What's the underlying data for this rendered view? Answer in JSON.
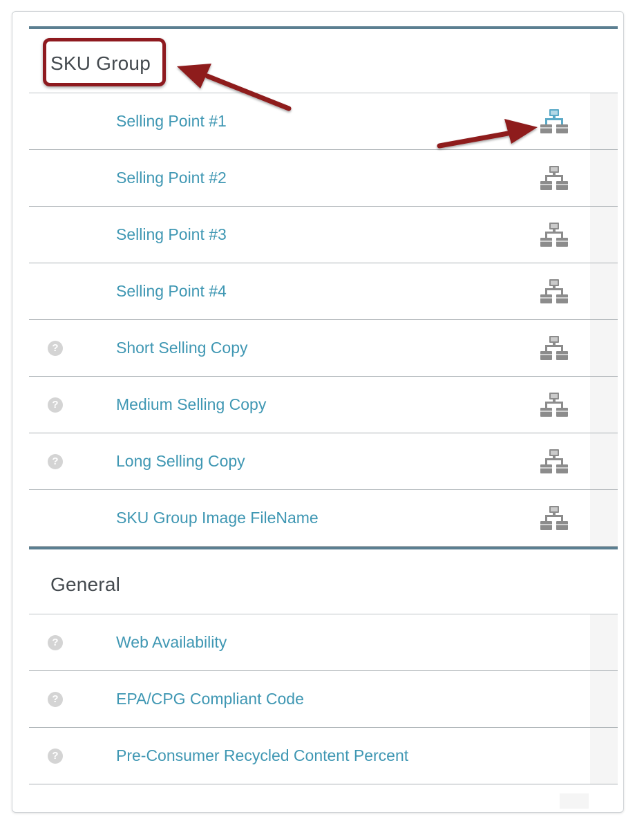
{
  "sections": [
    {
      "title": "SKU Group",
      "rows": [
        {
          "label": "Selling Point #1",
          "help": false,
          "sync_icon": "sync-icon",
          "sync_icon_color": "#5aa9c7"
        },
        {
          "label": "Selling Point #2",
          "help": false,
          "sync_icon": "sync-icon"
        },
        {
          "label": "Selling Point #3",
          "help": false,
          "sync_icon": "sync-icon"
        },
        {
          "label": "Selling Point #4",
          "help": false,
          "sync_icon": "sync-icon"
        },
        {
          "label": "Short Selling Copy",
          "help": true,
          "sync_icon": "sync-icon"
        },
        {
          "label": "Medium Selling Copy",
          "help": true,
          "sync_icon": "sync-icon"
        },
        {
          "label": "Long Selling Copy",
          "help": true,
          "sync_icon": "sync-icon"
        },
        {
          "label": "SKU Group Image FileName",
          "help": false,
          "sync_icon": "sync-icon"
        }
      ]
    },
    {
      "title": "General",
      "rows": [
        {
          "label": "Web Availability",
          "help": true
        },
        {
          "label": "EPA/CPG Compliant Code",
          "help": true
        },
        {
          "label": "Pre-Consumer Recycled Content Percent",
          "help": true
        }
      ]
    }
  ],
  "help_glyph": "?",
  "colors": {
    "accent_link": "#3f97b3",
    "section_bar": "#5b7f91",
    "annotation": "#8e1a1f",
    "icon_gray": "#8c8c8c",
    "icon_blue": "#5aa9c7"
  }
}
